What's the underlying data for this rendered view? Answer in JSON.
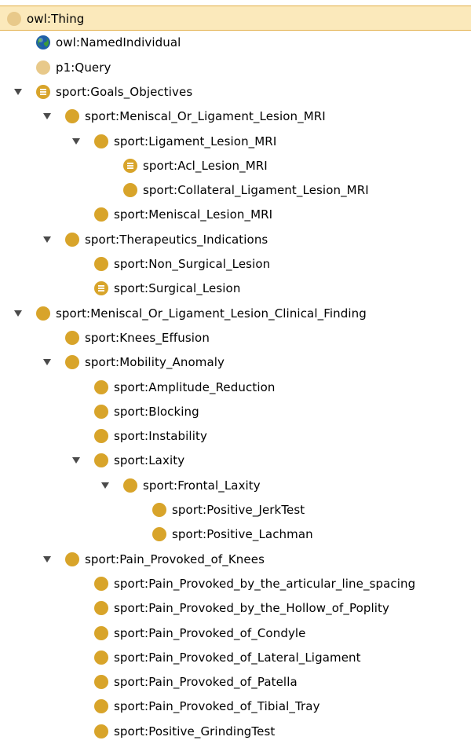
{
  "colors": {
    "selected_bg": "#fbe9bb",
    "selected_border": "#e3b04a",
    "class_icon": "#d8a42a",
    "class_icon_light": "#e8c98a",
    "defined_class_icon": "#d8a42a",
    "individual_icon": "#1f5fa8"
  },
  "tree": [
    {
      "depth": 0,
      "expanded": null,
      "icon": "class-icon-light",
      "label": "owl:Thing",
      "selected": true
    },
    {
      "depth": 1,
      "expanded": null,
      "icon": "globe-icon",
      "label": "owl:NamedIndividual"
    },
    {
      "depth": 1,
      "expanded": null,
      "icon": "class-icon-light",
      "label": "p1:Query"
    },
    {
      "depth": 1,
      "expanded": true,
      "icon": "defined-class-icon",
      "label": "sport:Goals_Objectives"
    },
    {
      "depth": 2,
      "expanded": true,
      "icon": "class-icon",
      "label": "sport:Meniscal_Or_Ligament_Lesion_MRI"
    },
    {
      "depth": 3,
      "expanded": true,
      "icon": "class-icon",
      "label": "sport:Ligament_Lesion_MRI"
    },
    {
      "depth": 4,
      "expanded": null,
      "icon": "defined-class-icon",
      "label": "sport:Acl_Lesion_MRI"
    },
    {
      "depth": 4,
      "expanded": null,
      "icon": "class-icon",
      "label": "sport:Collateral_Ligament_Lesion_MRI"
    },
    {
      "depth": 3,
      "expanded": null,
      "icon": "class-icon",
      "label": "sport:Meniscal_Lesion_MRI"
    },
    {
      "depth": 2,
      "expanded": true,
      "icon": "class-icon",
      "label": "sport:Therapeutics_Indications"
    },
    {
      "depth": 3,
      "expanded": null,
      "icon": "class-icon",
      "label": "sport:Non_Surgical_Lesion"
    },
    {
      "depth": 3,
      "expanded": null,
      "icon": "defined-class-icon",
      "label": "sport:Surgical_Lesion"
    },
    {
      "depth": 1,
      "expanded": true,
      "icon": "class-icon",
      "label": "sport:Meniscal_Or_Ligament_Lesion_Clinical_Finding"
    },
    {
      "depth": 2,
      "expanded": null,
      "icon": "class-icon",
      "label": "sport:Knees_Effusion"
    },
    {
      "depth": 2,
      "expanded": true,
      "icon": "class-icon",
      "label": "sport:Mobility_Anomaly"
    },
    {
      "depth": 3,
      "expanded": null,
      "icon": "class-icon",
      "label": "sport:Amplitude_Reduction"
    },
    {
      "depth": 3,
      "expanded": null,
      "icon": "class-icon",
      "label": "sport:Blocking"
    },
    {
      "depth": 3,
      "expanded": null,
      "icon": "class-icon",
      "label": "sport:Instability"
    },
    {
      "depth": 3,
      "expanded": true,
      "icon": "class-icon",
      "label": "sport:Laxity"
    },
    {
      "depth": 4,
      "expanded": true,
      "icon": "class-icon",
      "label": "sport:Frontal_Laxity"
    },
    {
      "depth": 5,
      "expanded": null,
      "icon": "class-icon",
      "label": "sport:Positive_JerkTest"
    },
    {
      "depth": 5,
      "expanded": null,
      "icon": "class-icon",
      "label": "sport:Positive_Lachman"
    },
    {
      "depth": 2,
      "expanded": true,
      "icon": "class-icon",
      "label": "sport:Pain_Provoked_of_Knees"
    },
    {
      "depth": 3,
      "expanded": null,
      "icon": "class-icon",
      "label": "sport:Pain_Provoked_by_the_articular_line_spacing"
    },
    {
      "depth": 3,
      "expanded": null,
      "icon": "class-icon",
      "label": "sport:Pain_Provoked_by_the_Hollow_of_Poplity"
    },
    {
      "depth": 3,
      "expanded": null,
      "icon": "class-icon",
      "label": "sport:Pain_Provoked_of_Condyle"
    },
    {
      "depth": 3,
      "expanded": null,
      "icon": "class-icon",
      "label": "sport:Pain_Provoked_of_Lateral_Ligament"
    },
    {
      "depth": 3,
      "expanded": null,
      "icon": "class-icon",
      "label": "sport:Pain_Provoked_of_Patella"
    },
    {
      "depth": 3,
      "expanded": null,
      "icon": "class-icon",
      "label": "sport:Pain_Provoked_of_Tibial_Tray"
    },
    {
      "depth": 3,
      "expanded": null,
      "icon": "class-icon",
      "label": "sport:Positive_GrindingTest"
    }
  ]
}
